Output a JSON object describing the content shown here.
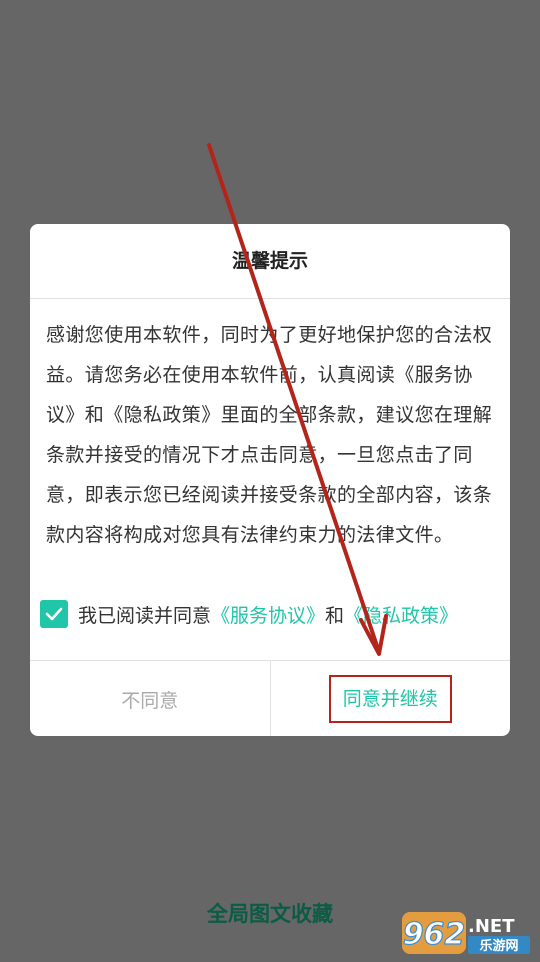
{
  "dialog": {
    "title": "温馨提示",
    "body": "感谢您使用本软件，同时为了更好地保护您的合法权益。请您务必在使用本软件前，认真阅读《服务协议》和《隐私政策》里面的全部条款，建议您在理解条款并接受的情况下才点击同意，一旦您点击了同意，即表示您已经阅读并接受条款的全部内容，该条款内容将构成对您具有法律约束力的法律文件。",
    "agree_prefix": "我已阅读并同意",
    "service_link": "《服务协议》",
    "and_text": "和",
    "privacy_link": "《隐私政策》",
    "disagree_label": "不同意",
    "agree_label": "同意并继续"
  },
  "footer": {
    "text": "全局图文收藏"
  },
  "watermark": {
    "brand": "962",
    "suffix": ".NET",
    "site": "乐游网"
  },
  "colors": {
    "accent": "#20c6a7",
    "overlay": "#666666",
    "annotation": "#b3251a"
  },
  "icons": {
    "checkbox": "checkmark-icon"
  }
}
